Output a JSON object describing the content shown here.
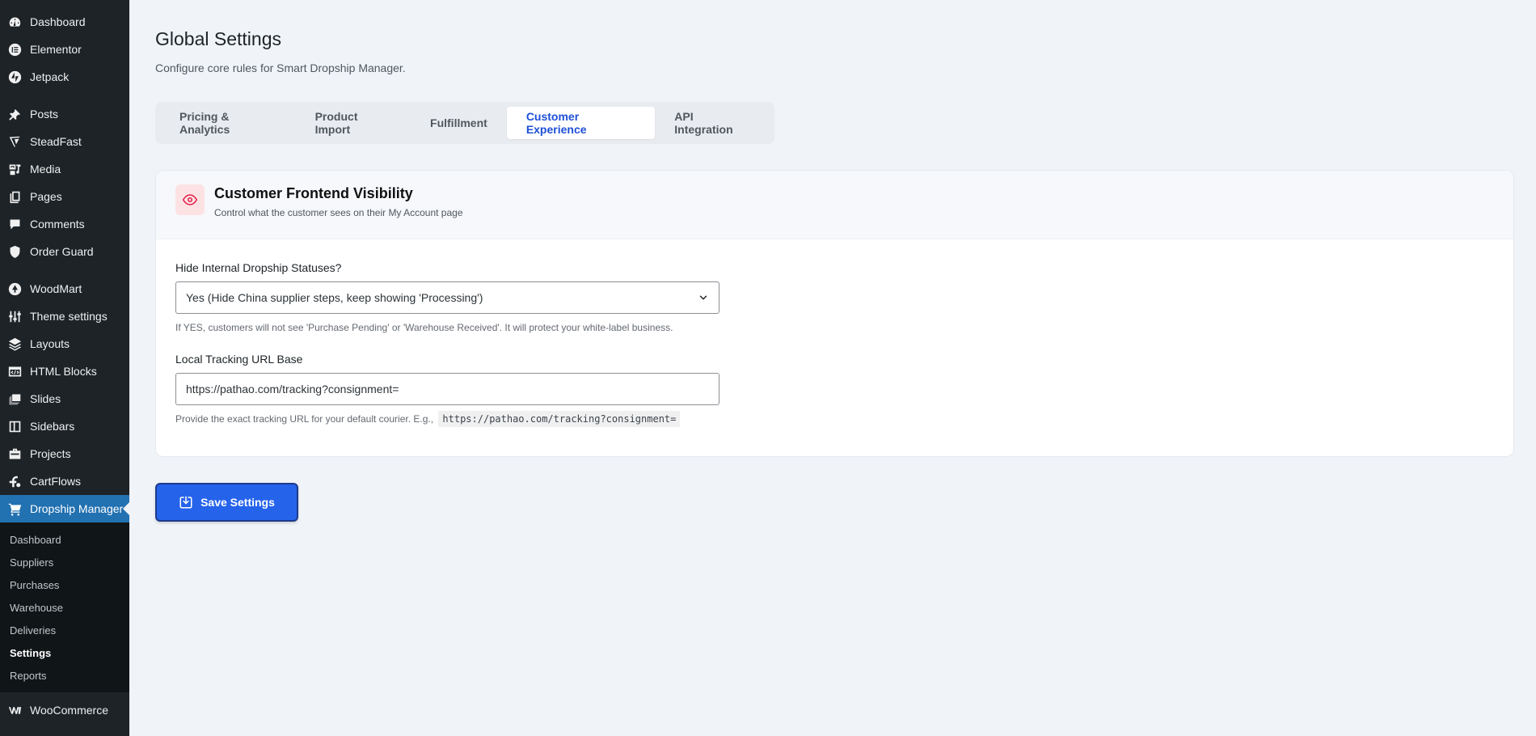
{
  "sidebar": {
    "items": [
      {
        "label": "Dashboard",
        "icon": "dashboard-icon"
      },
      {
        "label": "Elementor",
        "icon": "elementor-icon"
      },
      {
        "label": "Jetpack",
        "icon": "jetpack-icon"
      },
      {
        "label": "Posts",
        "icon": "pin-icon"
      },
      {
        "label": "SteadFast",
        "icon": "steadfast-icon"
      },
      {
        "label": "Media",
        "icon": "media-icon"
      },
      {
        "label": "Pages",
        "icon": "pages-icon"
      },
      {
        "label": "Comments",
        "icon": "comment-icon"
      },
      {
        "label": "Order Guard",
        "icon": "shield-icon"
      },
      {
        "label": "WoodMart",
        "icon": "woodmart-icon"
      },
      {
        "label": "Theme settings",
        "icon": "sliders-icon"
      },
      {
        "label": "Layouts",
        "icon": "layers-icon"
      },
      {
        "label": "HTML Blocks",
        "icon": "html-block-icon"
      },
      {
        "label": "Slides",
        "icon": "slides-icon"
      },
      {
        "label": "Sidebars",
        "icon": "sidebar-icon"
      },
      {
        "label": "Projects",
        "icon": "briefcase-icon"
      },
      {
        "label": "CartFlows",
        "icon": "cartflows-icon"
      },
      {
        "label": "Dropship Manager",
        "icon": "cart-icon"
      }
    ],
    "submenu": [
      "Dashboard",
      "Suppliers",
      "Purchases",
      "Warehouse",
      "Deliveries",
      "Settings",
      "Reports"
    ],
    "woocommerce": {
      "label": "WooCommerce",
      "icon": "woocommerce-icon"
    }
  },
  "header": {
    "title": "Global Settings",
    "subtitle": "Configure core rules for Smart Dropship Manager."
  },
  "tabs": [
    "Pricing & Analytics",
    "Product Import",
    "Fulfillment",
    "Customer Experience",
    "API Integration"
  ],
  "card": {
    "title": "Customer Frontend Visibility",
    "description": "Control what the customer sees on their My Account page",
    "icon": "eye-icon",
    "hide_statuses": {
      "label": "Hide Internal Dropship Statuses?",
      "value": "Yes (Hide China supplier steps, keep showing 'Processing')",
      "help": "If YES, customers will not see 'Purchase Pending' or 'Warehouse Received'. It will protect your white-label business."
    },
    "tracking": {
      "label": "Local Tracking URL Base",
      "value": "https://pathao.com/tracking?consignment=",
      "help": "Provide the exact tracking URL for your default courier. E.g.,",
      "example": "https://pathao.com/tracking?consignment="
    }
  },
  "save_button": "Save Settings",
  "colors": {
    "sidebar_bg": "#1d2327",
    "active_menu": "#2271b1",
    "accent_blue": "#2563eb",
    "tab_active_text": "#1e4fd8",
    "eye_icon": "#e11d48"
  }
}
